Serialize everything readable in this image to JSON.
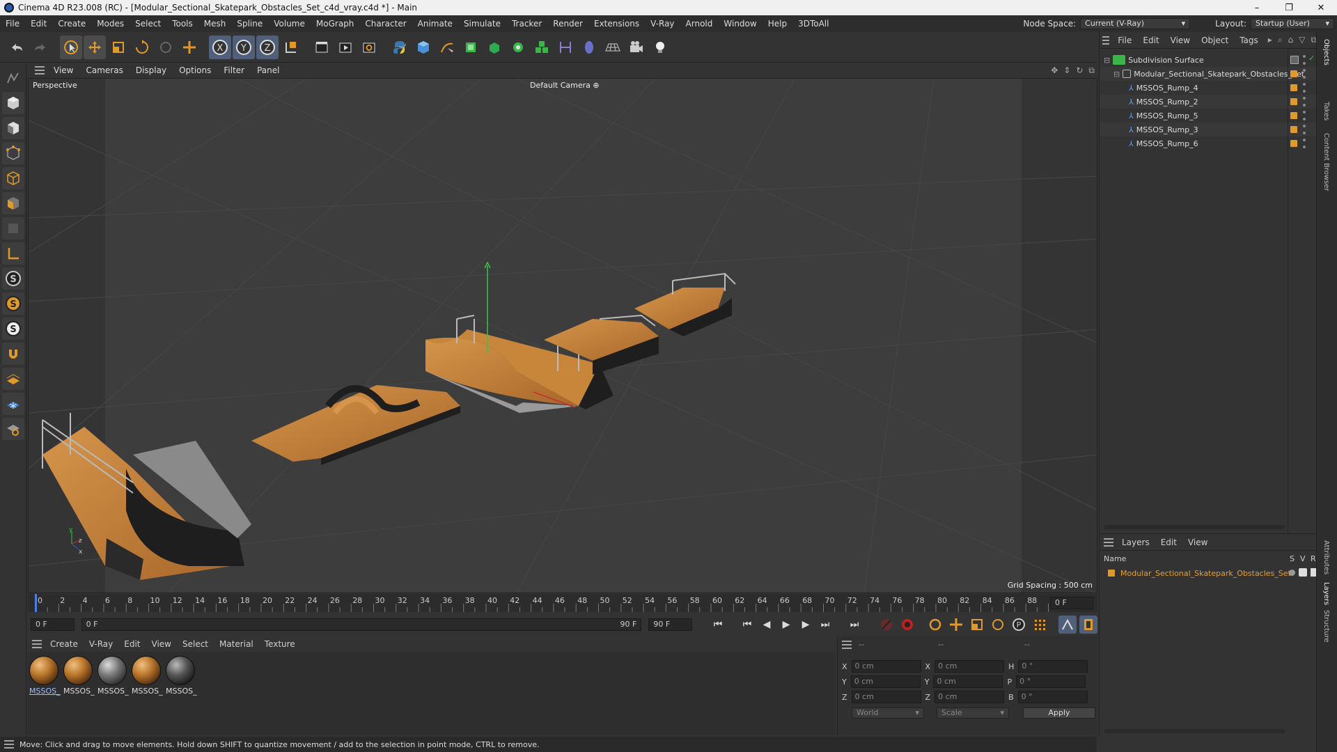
{
  "window": {
    "title": "Cinema 4D R23.008 (RC) - [Modular_Sectional_Skatepark_Obstacles_Set_c4d_vray.c4d *] - Main",
    "controls": [
      "–",
      "❐",
      "✕"
    ]
  },
  "menubar": {
    "items": [
      "File",
      "Edit",
      "Create",
      "Modes",
      "Select",
      "Tools",
      "Mesh",
      "Spline",
      "Volume",
      "MoGraph",
      "Character",
      "Animate",
      "Simulate",
      "Tracker",
      "Render",
      "Extensions",
      "V-Ray",
      "Arnold",
      "Window",
      "Help",
      "3DToAll"
    ],
    "node_space_label": "Node Space:",
    "node_space_value": "Current (V-Ray)",
    "layout_label": "Layout:",
    "layout_value": "Startup (User)"
  },
  "viewport_menu": {
    "items": [
      "View",
      "Cameras",
      "Display",
      "Options",
      "Filter",
      "Panel"
    ]
  },
  "viewport": {
    "label": "Perspective",
    "camera": "Default Camera",
    "grid_spacing": "Grid Spacing : 500 cm"
  },
  "timeline": {
    "ticks": [
      "0",
      "2",
      "4",
      "6",
      "8",
      "10",
      "12",
      "14",
      "16",
      "18",
      "20",
      "22",
      "24",
      "26",
      "28",
      "30",
      "32",
      "34",
      "36",
      "38",
      "40",
      "42",
      "44",
      "46",
      "48",
      "50",
      "52",
      "54",
      "56",
      "58",
      "60",
      "62",
      "64",
      "66",
      "68",
      "70",
      "72",
      "74",
      "76",
      "78",
      "80",
      "82",
      "84",
      "86",
      "88",
      "90"
    ],
    "current_frame": "0 F",
    "start_frame": "0 F",
    "range_start": "0 F",
    "range_end": "90 F",
    "end_frame": "90 F"
  },
  "materials": {
    "menu": [
      "Create",
      "V-Ray",
      "Edit",
      "View",
      "Select",
      "Material",
      "Texture"
    ],
    "items": [
      "MSSOS_",
      "MSSOS_",
      "MSSOS_",
      "MSSOS_",
      "MSSOS_"
    ]
  },
  "coordinates": {
    "header_a": "--",
    "header_b": "--",
    "header_c": "--",
    "rows": [
      {
        "a": "X",
        "av": "0 cm",
        "b": "X",
        "bv": "0 cm",
        "c": "H",
        "cv": "0 °"
      },
      {
        "a": "Y",
        "av": "0 cm",
        "b": "Y",
        "bv": "0 cm",
        "c": "P",
        "cv": "0 °"
      },
      {
        "a": "Z",
        "av": "0 cm",
        "b": "Z",
        "bv": "0 cm",
        "c": "B",
        "cv": "0 °"
      }
    ],
    "mode": "World",
    "scale": "Scale",
    "apply": "Apply"
  },
  "objects": {
    "menu": [
      "File",
      "Edit",
      "View",
      "Object",
      "Tags"
    ],
    "items": [
      {
        "name": "Subdivision Surface",
        "indent": 0
      },
      {
        "name": "Modular_Sectional_Skatepark_Obstacles_Set",
        "indent": 1
      },
      {
        "name": "MSSOS_Rump_4",
        "indent": 2
      },
      {
        "name": "MSSOS_Rump_2",
        "indent": 2
      },
      {
        "name": "MSSOS_Rump_5",
        "indent": 2
      },
      {
        "name": "MSSOS_Rump_3",
        "indent": 2
      },
      {
        "name": "MSSOS_Rump_6",
        "indent": 2
      }
    ]
  },
  "layers": {
    "menu": [
      "Layers",
      "Edit",
      "View"
    ],
    "col_name": "Name",
    "col_s": "S",
    "col_v": "V",
    "col_r": "R",
    "items": [
      "Modular_Sectional_Skatepark_Obstacles_Set"
    ]
  },
  "side_tabs": [
    "Objects",
    "Takes",
    "Content Browser",
    "Attributes",
    "Layers",
    "Structure"
  ],
  "status": "Move: Click and drag to move elements. Hold down SHIFT to quantize movement / add to the selection in point mode, CTRL to remove.",
  "colors": {
    "accent_orange": "#e09a2a",
    "wood": "#c8863a",
    "selection_blue": "#50607a"
  }
}
